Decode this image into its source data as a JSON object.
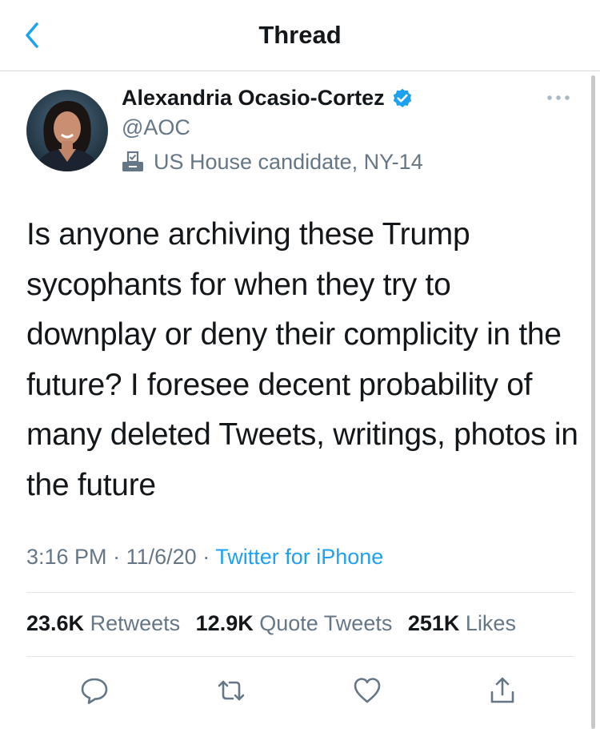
{
  "header": {
    "title": "Thread",
    "back_icon": "chevron-left-icon"
  },
  "tweet": {
    "author_name": "Alexandria Ocasio-Cortez",
    "handle": "@AOC",
    "label": "US House candidate, NY-14",
    "text": "Is anyone archiving these Trump sycophants for when they try to downplay or deny their complicity in the future? I foresee decent probability of many deleted Tweets, writings, photos in the future",
    "time": "3:16 PM",
    "date": "11/6/20",
    "separator": "·",
    "source": "Twitter for iPhone"
  },
  "stats": {
    "retweets_count": "23.6K",
    "retweets_label": "Retweets",
    "quotes_count": "12.9K",
    "quotes_label": "Quote Tweets",
    "likes_count": "251K",
    "likes_label": "Likes"
  },
  "actions": [
    "reply-icon",
    "retweet-icon",
    "like-icon",
    "share-icon"
  ],
  "colors": {
    "accent": "#1da1f2",
    "secondary_text": "#657786",
    "primary_text": "#14171a",
    "divider": "#e1e8ed"
  }
}
